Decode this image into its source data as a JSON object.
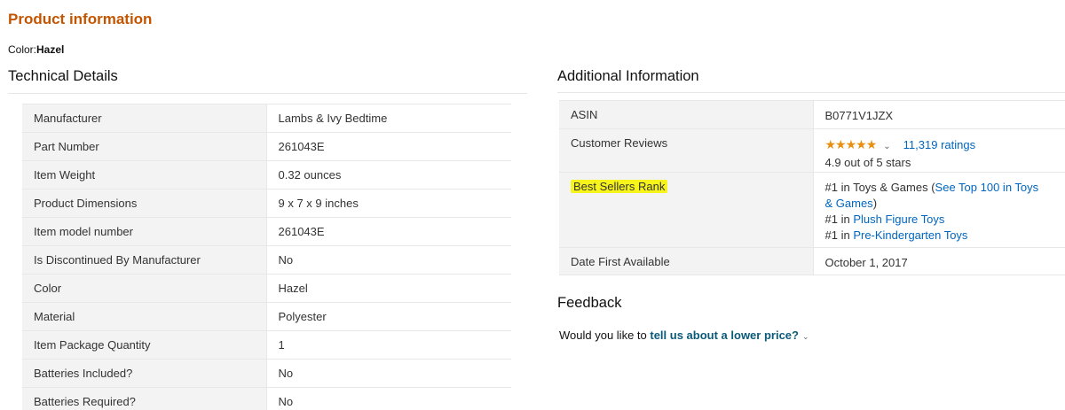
{
  "title": "Product information",
  "color_label": "Color:",
  "color_value": "Hazel",
  "technical": {
    "heading": "Technical Details",
    "rows": [
      {
        "key": "Manufacturer",
        "value": "Lambs & Ivy Bedtime"
      },
      {
        "key": "Part Number",
        "value": "261043E"
      },
      {
        "key": "Item Weight",
        "value": "0.32 ounces"
      },
      {
        "key": "Product Dimensions",
        "value": "9 x 7 x 9 inches"
      },
      {
        "key": "Item model number",
        "value": "261043E"
      },
      {
        "key": "Is Discontinued By Manufacturer",
        "value": "No"
      },
      {
        "key": "Color",
        "value": "Hazel"
      },
      {
        "key": "Material",
        "value": "Polyester"
      },
      {
        "key": "Item Package Quantity",
        "value": "1"
      },
      {
        "key": "Batteries Included?",
        "value": "No"
      },
      {
        "key": "Batteries Required?",
        "value": "No"
      }
    ]
  },
  "additional": {
    "heading": "Additional Information",
    "asin_key": "ASIN",
    "asin_value": "B0771V1JZX",
    "reviews_key": "Customer Reviews",
    "stars": "★★★★★",
    "chevron": "⌄",
    "ratings_link": "11,319 ratings",
    "stars_text": "4.9 out of 5 stars",
    "rank_key": "Best Sellers Rank",
    "rank": [
      {
        "prefix": "#1 in Toys & Games (",
        "link": "See Top 100 in Toys & Games",
        "suffix": ")"
      },
      {
        "prefix": "#1 in ",
        "link": "Plush Figure Toys",
        "suffix": ""
      },
      {
        "prefix": "#1 in ",
        "link": "Pre-Kindergarten Toys",
        "suffix": ""
      }
    ],
    "date_key": "Date First Available",
    "date_value": "October 1, 2017"
  },
  "feedback": {
    "heading": "Feedback",
    "question": "Would you like to ",
    "link": "tell us about a lower price?",
    "chevron": "⌄"
  },
  "colors": {
    "title": "#c45500",
    "link": "#0066c0",
    "star": "#e88f11",
    "highlight": "#f7f41c",
    "key_bg": "#f3f3f3"
  }
}
